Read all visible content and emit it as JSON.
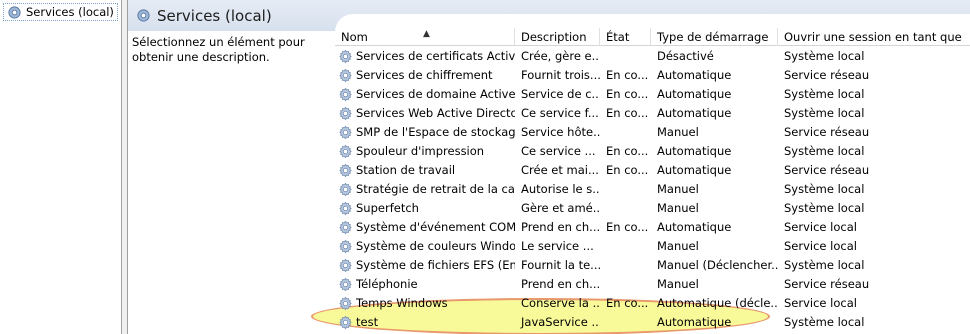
{
  "tree": {
    "label": "Services (local)"
  },
  "header": {
    "title": "Services (local)"
  },
  "description_pane": {
    "text": "Sélectionnez un élément pour obtenir une description."
  },
  "columns": {
    "name": "Nom",
    "description": "Description",
    "state": "État",
    "startup": "Type de démarrage",
    "logon": "Ouvrir une session en tant que"
  },
  "rows": [
    {
      "name": "Services de certificats Activ...",
      "description": "Crée, gère e...",
      "state": "",
      "startup": "Désactivé",
      "logon": "Système local"
    },
    {
      "name": "Services de chiffrement",
      "description": "Fournit trois...",
      "state": "En co...",
      "startup": "Automatique",
      "logon": "Service réseau"
    },
    {
      "name": "Services de domaine Active ...",
      "description": "Service de c...",
      "state": "En co...",
      "startup": "Automatique",
      "logon": "Système local"
    },
    {
      "name": "Services Web Active Directory",
      "description": "Ce service f...",
      "state": "En co...",
      "startup": "Automatique",
      "logon": "Système local"
    },
    {
      "name": "SMP de l'Espace de stockag...",
      "description": "Service hôte...",
      "state": "",
      "startup": "Manuel",
      "logon": "Service réseau"
    },
    {
      "name": "Spouleur d'impression",
      "description": "Ce service ...",
      "state": "En co...",
      "startup": "Automatique",
      "logon": "Système local"
    },
    {
      "name": "Station de travail",
      "description": "Crée et mai...",
      "state": "En co...",
      "startup": "Automatique",
      "logon": "Service réseau"
    },
    {
      "name": "Stratégie de retrait de la cart...",
      "description": "Autorise le s...",
      "state": "",
      "startup": "Manuel",
      "logon": "Système local"
    },
    {
      "name": "Superfetch",
      "description": "Gère et amé...",
      "state": "",
      "startup": "Manuel",
      "logon": "Système local"
    },
    {
      "name": "Système d'événement COM+",
      "description": "Prend en ch...",
      "state": "En co...",
      "startup": "Automatique",
      "logon": "Service local"
    },
    {
      "name": "Système de couleurs Windo...",
      "description": "Le service ...",
      "state": "",
      "startup": "Manuel",
      "logon": "Service local"
    },
    {
      "name": "Système de fichiers EFS (En...",
      "description": "Fournit la te...",
      "state": "",
      "startup": "Manuel (Déclencher...",
      "logon": "Système local"
    },
    {
      "name": "Téléphonie",
      "description": "Prend en ch...",
      "state": "",
      "startup": "Manuel",
      "logon": "Service réseau"
    },
    {
      "name": "Temps Windows",
      "description": "Conserve la ...",
      "state": "En co...",
      "startup": "Automatique (décle...",
      "logon": "Service local"
    },
    {
      "name": "test",
      "description": "JavaService ...",
      "state": "",
      "startup": "Automatique",
      "logon": "Système local"
    }
  ],
  "icons": {
    "service": "gear-icon",
    "sort": "sort-ascending-arrow"
  },
  "colors": {
    "banner": "#dbe3ef",
    "highlight_fill": "#f5f878",
    "highlight_border": "#e8986a"
  }
}
